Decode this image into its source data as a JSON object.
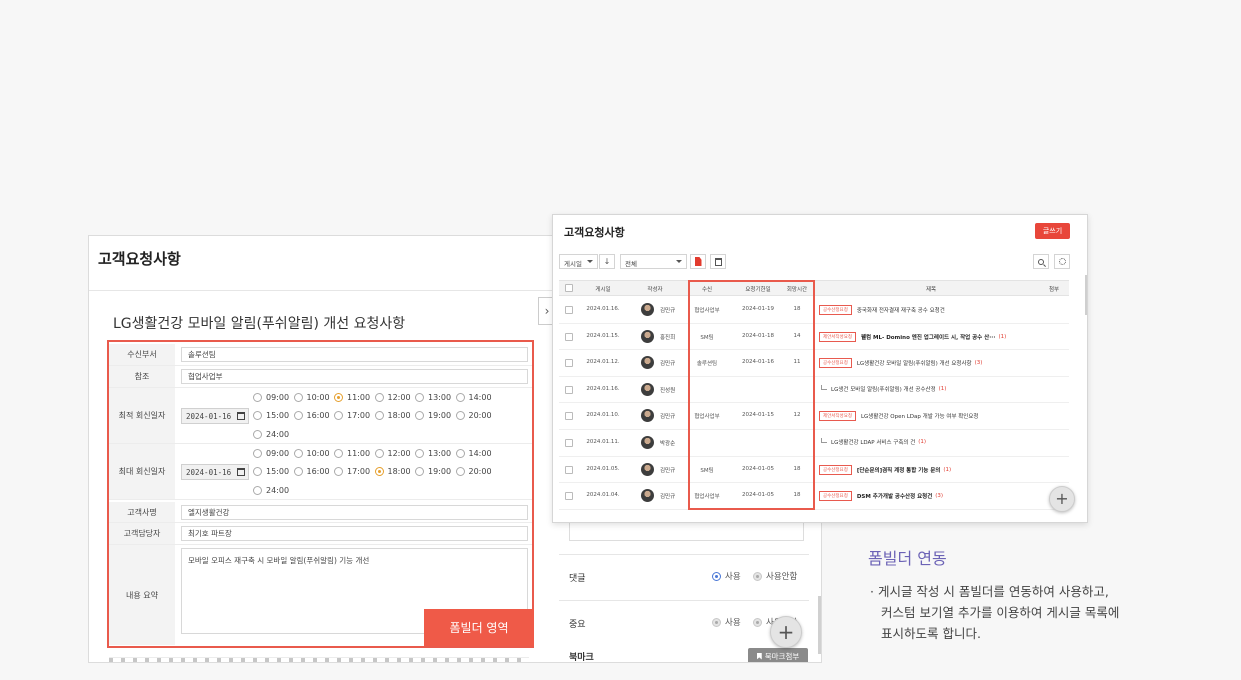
{
  "form_window": {
    "title": "고객요청사항",
    "post_title": "LG생활건강 모바일 알림(푸쉬알림) 개선 요청사항",
    "fields": {
      "recv_dept": {
        "label": "수신부서",
        "value": "솔루션팀"
      },
      "ref": {
        "label": "참조",
        "value": "협업사업부"
      },
      "earliest": {
        "label": "최적 회신일자",
        "date": "2024-01-16",
        "times": [
          "09:00",
          "10:00",
          "11:00",
          "12:00",
          "13:00",
          "14:00",
          "15:00",
          "16:00",
          "17:00",
          "18:00",
          "19:00",
          "20:00",
          "24:00"
        ],
        "selected": "11:00"
      },
      "latest": {
        "label": "최대 회신일자",
        "date": "2024-01-16",
        "times": [
          "09:00",
          "10:00",
          "11:00",
          "12:00",
          "13:00",
          "14:00",
          "15:00",
          "16:00",
          "17:00",
          "18:00",
          "19:00",
          "20:00",
          "24:00"
        ],
        "selected": "18:00"
      },
      "customer": {
        "label": "고객사명",
        "value": "엘지생활건강"
      },
      "contact": {
        "label": "고객담당자",
        "value": "최기호 파트장"
      },
      "summary": {
        "label": "내용 요약",
        "value": "모바일 오피스 재구축 시  모바일 알림(푸쉬알림) 기능 개선"
      }
    },
    "badge": "폼빌더 영역",
    "settings": {
      "comment": {
        "label": "댓글",
        "opt_on": "사용",
        "opt_off": "사용안함"
      },
      "important": {
        "label": "중요",
        "opt_on": "사용",
        "opt_off": "사용안함"
      },
      "bookmark": {
        "label": "북마크",
        "button": "북마크첨부"
      }
    },
    "fab": "+"
  },
  "list_window": {
    "title": "고객요청사항",
    "write_button": "글쓰기",
    "sort_select": "게시일",
    "sort_dir": "↓",
    "filter_select": "전체",
    "columns": [
      "게시일",
      "작성자",
      "수신",
      "요청기한일",
      "회망시간",
      "제목",
      "첨부"
    ],
    "rows": [
      {
        "date": "2024.01.16.",
        "author": "김민규",
        "recv": "협업사업부",
        "due": "2024-01-19",
        "hour": "18",
        "tag": "공수산정요청",
        "subject": "중국화재 전자결재 재구축 공수 요청건",
        "count": "",
        "bold": false,
        "reply": false
      },
      {
        "date": "2024.01.15.",
        "author": "홍진희",
        "recv": "SM팀",
        "due": "2024-01-18",
        "hour": "14",
        "tag": "제안서작성요청",
        "subject": "웰컴 ML- Domino 엔진 업그레이드 시, 작업 공수 산···",
        "count": "(1)",
        "bold": true,
        "reply": false
      },
      {
        "date": "2024.01.12.",
        "author": "김민규",
        "recv": "솔루션팀",
        "due": "2024-01-16",
        "hour": "11",
        "tag": "공수산정요청",
        "subject": "LG생활건강 모바일 알림(푸쉬알림) 개선 요청사항",
        "count": "(3)",
        "bold": false,
        "reply": false
      },
      {
        "date": "2024.01.16.",
        "author": "진성원",
        "recv": "",
        "due": "",
        "hour": "",
        "tag": "",
        "subject": "LG생건 모바일 알림(푸쉬알림) 개선 공수산정",
        "count": "(1)",
        "bold": false,
        "reply": true
      },
      {
        "date": "2024.01.10.",
        "author": "김민규",
        "recv": "협업사업부",
        "due": "2024-01-15",
        "hour": "12",
        "tag": "제안서작성요청",
        "subject": "LG생활건강 Open LDap 개발 가능 여부 확인요청",
        "count": "",
        "bold": false,
        "reply": false
      },
      {
        "date": "2024.01.11.",
        "author": "박광순",
        "recv": "",
        "due": "",
        "hour": "",
        "tag": "",
        "subject": "LG생활건강 LDAP 서비스 구축의 건",
        "count": "(1)",
        "bold": false,
        "reply": true
      },
      {
        "date": "2024.01.05.",
        "author": "김민규",
        "recv": "SM팀",
        "due": "2024-01-05",
        "hour": "18",
        "tag": "공수산정요청",
        "subject": "[단순문의]겸직 계정 통합 기능 문의",
        "count": "(1)",
        "bold": true,
        "reply": false
      },
      {
        "date": "2024.01.04.",
        "author": "김민규",
        "recv": "협업사업부",
        "due": "2024-01-05",
        "hour": "18",
        "tag": "공수산정요청",
        "subject": "DSM 추가개발 공수산정 요청건",
        "count": "(3)",
        "bold": true,
        "reply": false
      }
    ],
    "fab": "+"
  },
  "feature": {
    "title": "폼빌더 연동",
    "desc": [
      "· 게시글 작성 시 폼빌더를 연동하여 사용하고,",
      "커스텀 보기열 추가를 이용하여 게시글 목록에",
      "표시하도록 합니다."
    ]
  },
  "colors": {
    "accent_red": "#e95a4c",
    "feature_purple": "#6c63b6"
  }
}
